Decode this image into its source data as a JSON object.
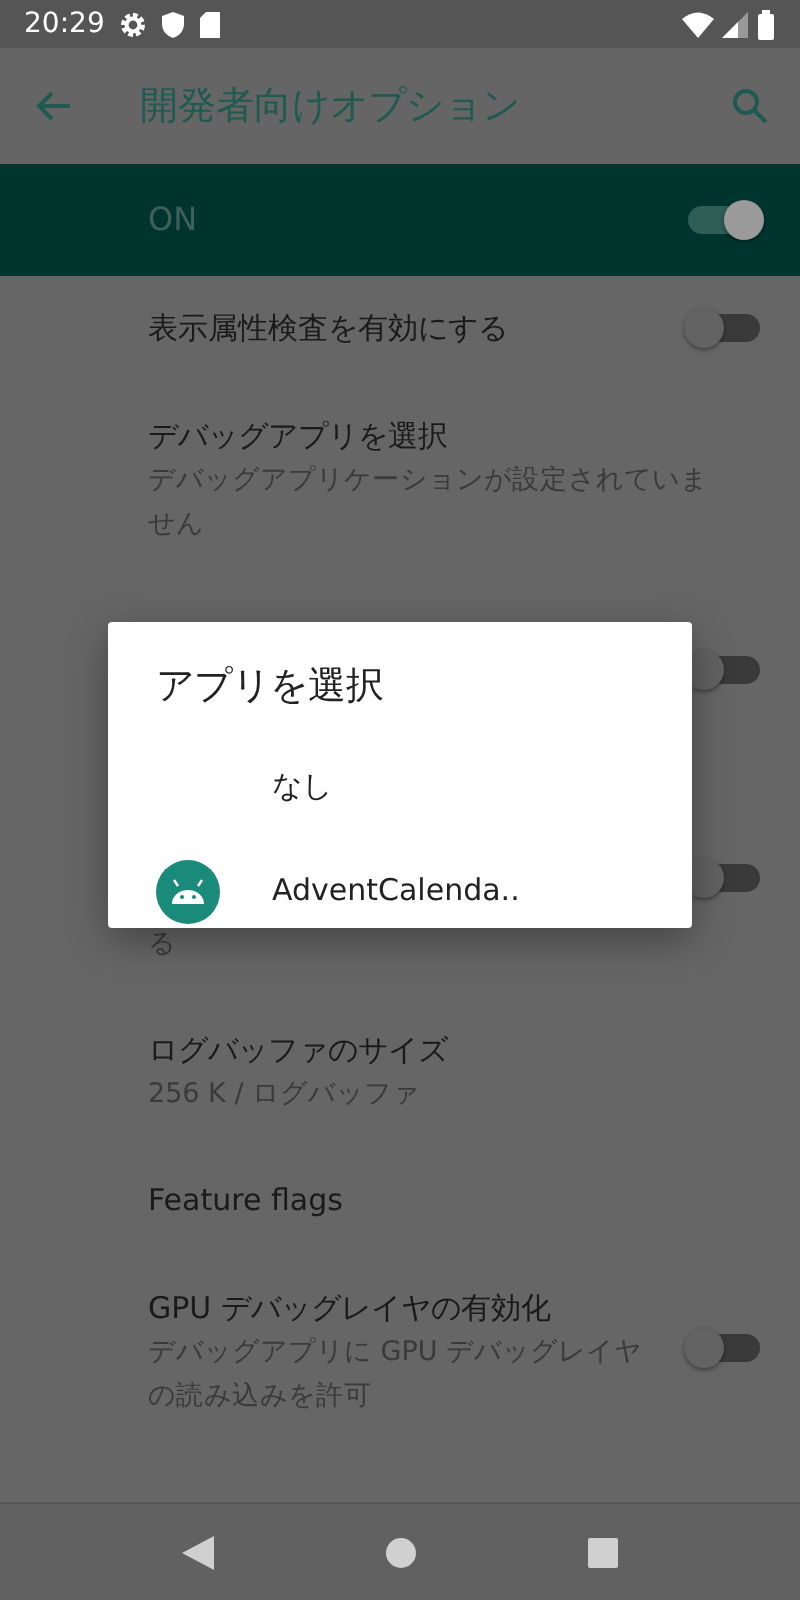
{
  "status_bar": {
    "time": "20:29"
  },
  "app_bar": {
    "title": "開発者向けオプション"
  },
  "master_switch": {
    "label": "ON",
    "on": true
  },
  "settings": [
    {
      "kind": "switch",
      "title": "表示属性検査を有効にする",
      "on": false
    },
    {
      "kind": "plain",
      "title": "デバッグアプリを選択",
      "summary": "デバッグアプリケーションが設定されていません"
    },
    {
      "kind": "switch",
      "on": false
    },
    {
      "kind": "switch",
      "summary": "る",
      "on": false
    },
    {
      "kind": "plain",
      "title": "ログバッファのサイズ",
      "summary": "256 K / ログバッファ"
    },
    {
      "kind": "plain",
      "title": "Feature flags"
    },
    {
      "kind": "switch",
      "title": "GPU デバッグレイヤの有効化",
      "summary": "デバッグアプリに GPU デバッグレイヤの読み込みを許可",
      "on": false
    }
  ],
  "dialog": {
    "title": "アプリを選択",
    "options": [
      {
        "kind": "none",
        "label": "なし"
      },
      {
        "kind": "app",
        "label": "AdventCalenda.."
      }
    ]
  }
}
